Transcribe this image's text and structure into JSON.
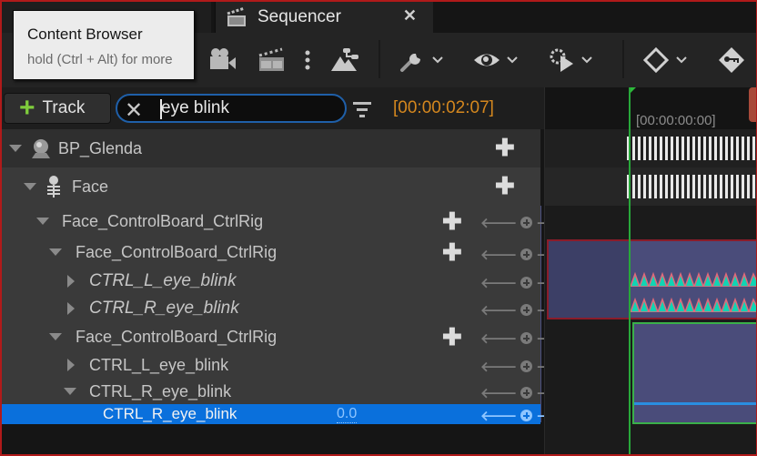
{
  "tabs": [
    {
      "label": "Content Browser",
      "active": false
    },
    {
      "label": "Sequencer",
      "active": true,
      "close_icon": "close-icon"
    }
  ],
  "tooltip": {
    "title": "Content Browser",
    "hint": "hold (Ctrl + Alt) for more"
  },
  "toolbar": {
    "icons": [
      "camera-icon",
      "clapperboard-icon",
      "more-vertical-icon",
      "landscape-hierarchy-icon",
      "wrench-icon",
      "eye-icon",
      "playback-settings-icon",
      "keyframe-diamond-icon",
      "key-icon"
    ]
  },
  "filter_bar": {
    "add_track_label": "Track",
    "search_value": "eye blink",
    "current_time": "[00:00:02:07]"
  },
  "timeline": {
    "ruler_start": "[00:00:00:00]"
  },
  "tree": {
    "rows": [
      {
        "label": "BP_Glenda",
        "icon": "actor-sphere-icon",
        "expanded": true,
        "add": true
      },
      {
        "label": "Face",
        "icon": "skeleton-icon",
        "expanded": true,
        "add": true
      },
      {
        "label": "Face_ControlBoard_CtrlRig",
        "expanded": true,
        "add": true,
        "nav": true
      },
      {
        "label": "Face_ControlBoard_CtrlRig",
        "expanded": true,
        "add": true,
        "nav": true
      },
      {
        "label": "CTRL_L_eye_blink",
        "expanded": false,
        "italic": true,
        "nav": true
      },
      {
        "label": "CTRL_R_eye_blink",
        "expanded": false,
        "italic": true,
        "nav": true
      },
      {
        "label": "Face_ControlBoard_CtrlRig",
        "expanded": true,
        "add": true,
        "nav": true
      },
      {
        "label": "CTRL_L_eye_blink",
        "expanded": false,
        "nav": true
      },
      {
        "label": "CTRL_R_eye_blink",
        "expanded": true,
        "nav": true
      },
      {
        "label": "CTRL_R_eye_blink",
        "selected": true,
        "value": "0.0",
        "nav": true
      }
    ]
  },
  "colors": {
    "accent_selection": "#0a70dc",
    "timecode": "#d4871e",
    "playhead": "#28a83a",
    "add_track_plus": "#7fcd3c",
    "search_border": "#1f5fa8"
  }
}
